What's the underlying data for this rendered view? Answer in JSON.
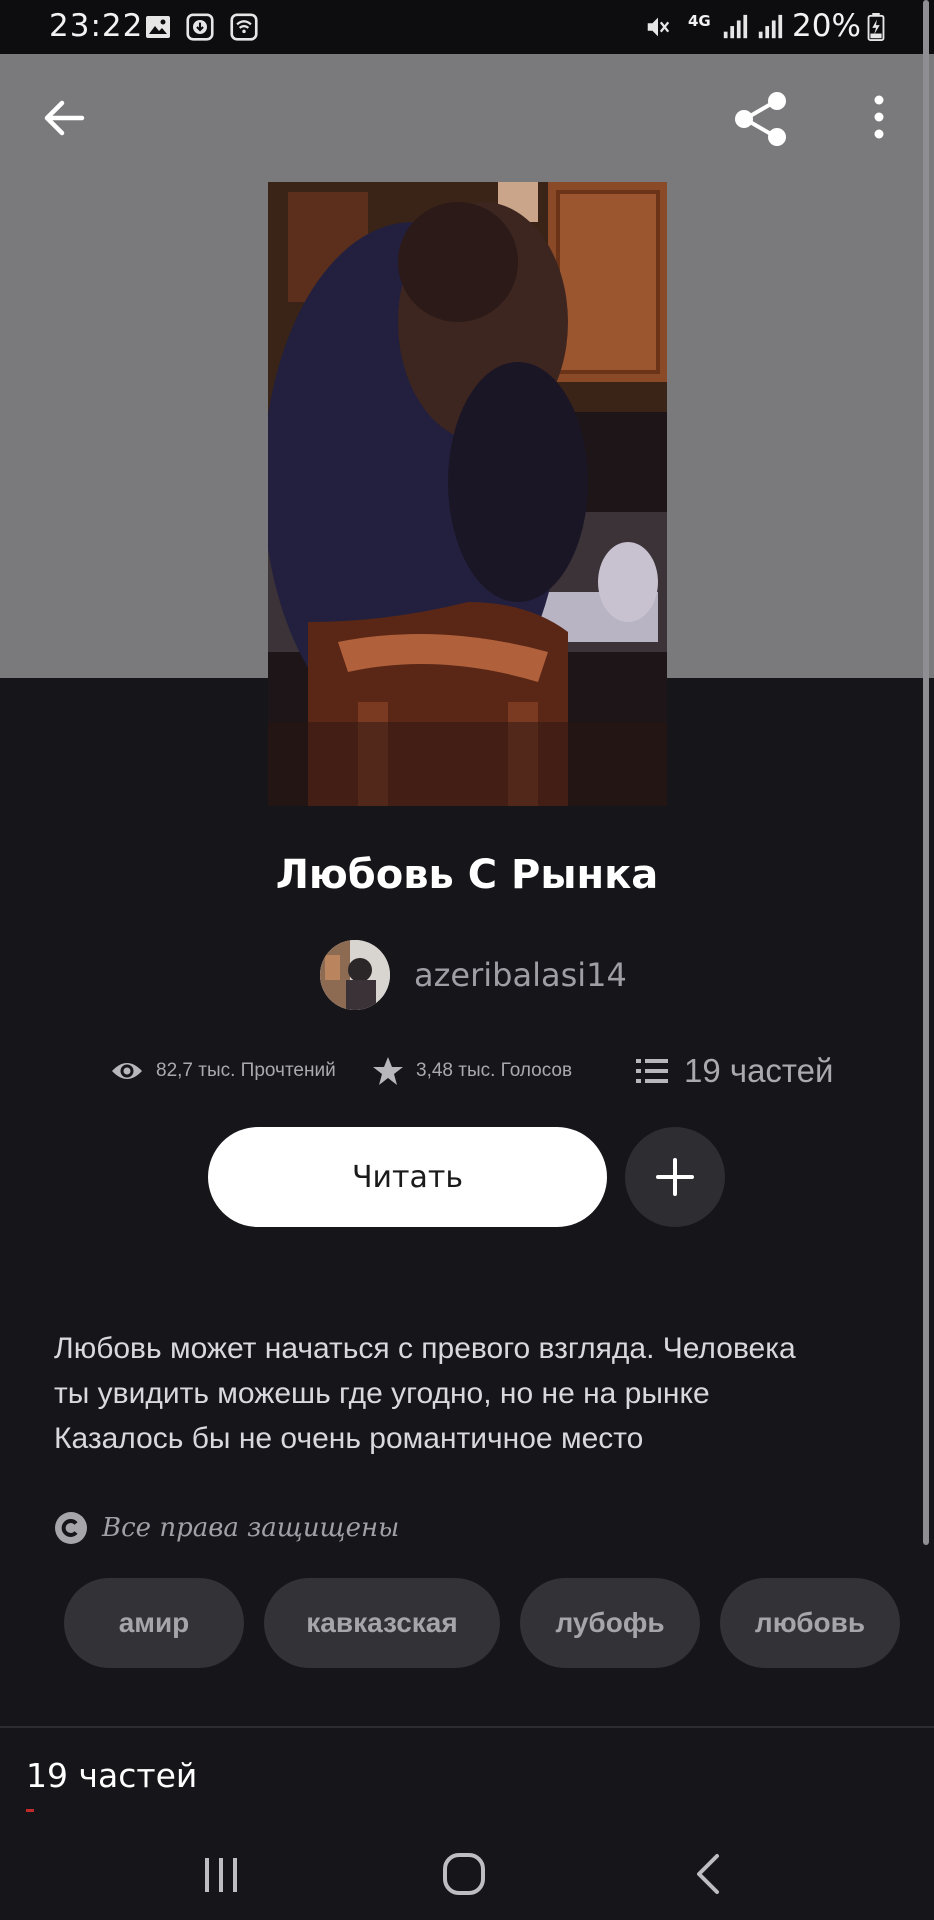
{
  "status_bar": {
    "time": "23:22",
    "network": "4G",
    "battery": "20%",
    "icons": [
      "gallery-icon",
      "download-icon",
      "wifi-icon",
      "mute-icon",
      "signal-icon",
      "battery-charging-icon"
    ]
  },
  "toolbar": {
    "back_icon": "arrow-left-icon",
    "share_icon": "share-icon",
    "more_icon": "more-vert-icon"
  },
  "story": {
    "title": "Любовь С Рынка",
    "author": "azeribalasi14",
    "cover_description_color": "#2a1a22"
  },
  "stats": {
    "reads": "82,7 тыс. Прочтений",
    "votes": "3,48 тыс. Голосов",
    "parts": "19 частей"
  },
  "actions": {
    "read_label": "Читать",
    "add_icon": "plus-icon"
  },
  "description": {
    "line1": "Любовь может начаться с превого взгляда. Человека",
    "line2": "ты увидить можешь где угодно, но не на рынке",
    "line3": "Казалось бы не очень романтичное место"
  },
  "rights": {
    "label": "Все права защищены"
  },
  "tags": [
    "амир",
    "кавказская",
    "лубофь",
    "любовь"
  ],
  "footer": {
    "parts_label": "19 частей"
  },
  "colors": {
    "background": "#161519",
    "header": "#7a7a7c",
    "tag_bg": "#333237",
    "button_primary": "#ffffff",
    "accent_red": "#c12a2a"
  }
}
